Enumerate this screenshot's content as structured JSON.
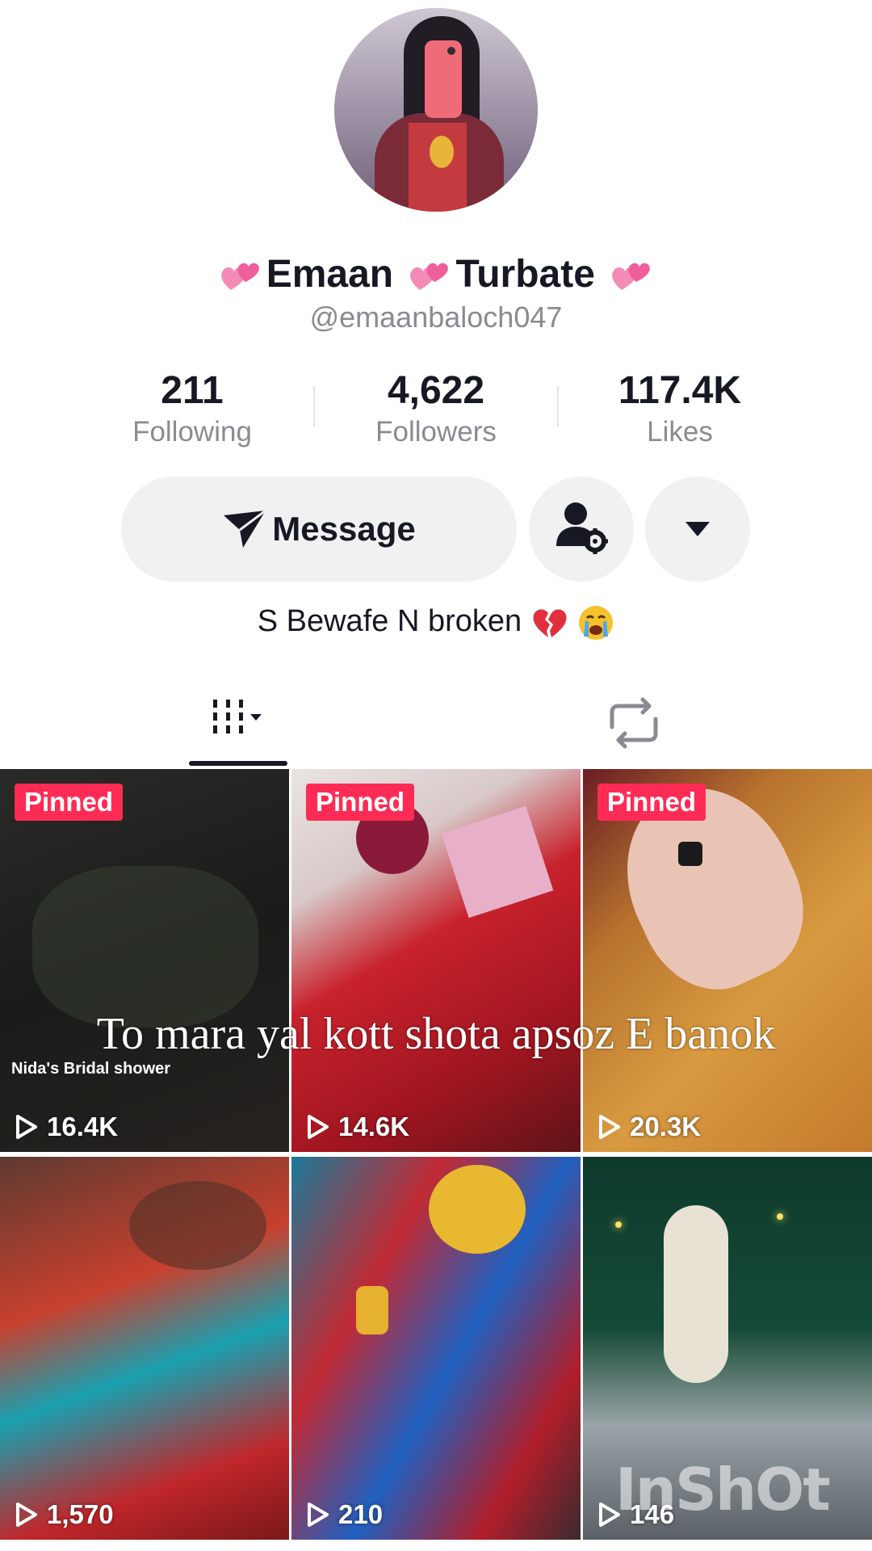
{
  "profile": {
    "display_name_part1": "Emaan",
    "display_name_part2": "Turbate",
    "handle": "@emaanbaloch047",
    "bio": "S Bewafe N broken"
  },
  "stats": [
    {
      "value": "211",
      "label": "Following"
    },
    {
      "value": "4,622",
      "label": "Followers"
    },
    {
      "value": "117.4K",
      "label": "Likes"
    }
  ],
  "actions": {
    "message_label": "Message"
  },
  "tabs": [
    {
      "name": "videos",
      "icon": "grid-icon"
    },
    {
      "name": "reposts",
      "icon": "repost-icon"
    }
  ],
  "videos": [
    {
      "pinned": "Pinned",
      "views": "16.4K",
      "caption": "Nida's Bridal shower"
    },
    {
      "pinned": "Pinned",
      "views": "14.6K"
    },
    {
      "pinned": "Pinned",
      "views": "20.3K"
    },
    {
      "views": "1,570"
    },
    {
      "views": "210"
    },
    {
      "views": "146"
    }
  ],
  "overlay": {
    "caption": "To mara yal kott shota apsoz E banok",
    "watermark": "InShOt"
  },
  "colors": {
    "accent": "#fe2c55",
    "text": "#161823",
    "secondary_text": "#8a8b91",
    "button_bg": "#f1f1f2"
  }
}
